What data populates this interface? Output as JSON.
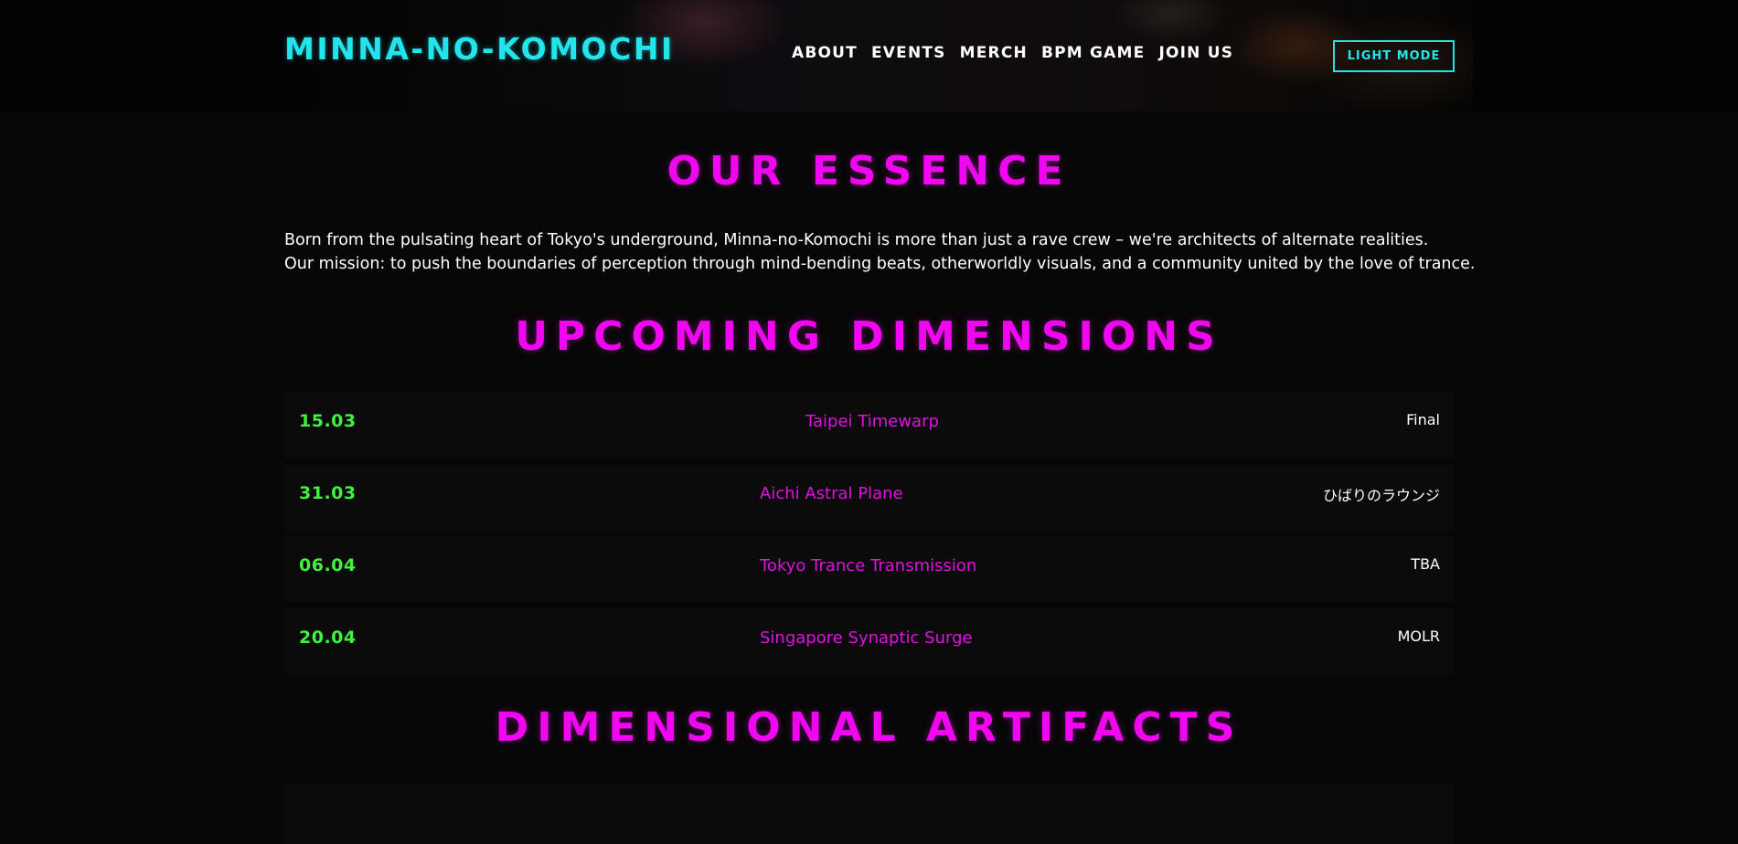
{
  "header": {
    "logo": "MINNA-NO-KOMOCHI",
    "nav": [
      "ABOUT",
      "EVENTS",
      "MERCH",
      "BPM GAME",
      "JOIN US"
    ],
    "theme_toggle": "LIGHT MODE"
  },
  "about": {
    "title": "OUR ESSENCE",
    "lines": [
      "Born from the pulsating heart of Tokyo's underground, Minna-no-Komochi is more than just a rave crew – we're architects of alternate realities.",
      "Our mission: to push the boundaries of perception through mind-bending beats, otherworldly visuals, and a community united by the love of trance."
    ]
  },
  "events": {
    "title": "UPCOMING DIMENSIONS",
    "items": [
      {
        "date": "15.03",
        "name": "Taipei Timewarp",
        "venue": "Final"
      },
      {
        "date": "31.03",
        "name": "Aichi Astral Plane",
        "venue": "ひばりのラウンジ"
      },
      {
        "date": "06.04",
        "name": "Tokyo Trance Transmission",
        "venue": "TBA"
      },
      {
        "date": "20.04",
        "name": "Singapore Synaptic Surge",
        "venue": "MOLR"
      }
    ]
  },
  "artifacts": {
    "title": "DIMENSIONAL ARTIFACTS"
  },
  "colors": {
    "accent_cyan": "#22e5ec",
    "accent_magenta": "#f007f0",
    "accent_green": "#3ef23e",
    "background": "#070707"
  }
}
